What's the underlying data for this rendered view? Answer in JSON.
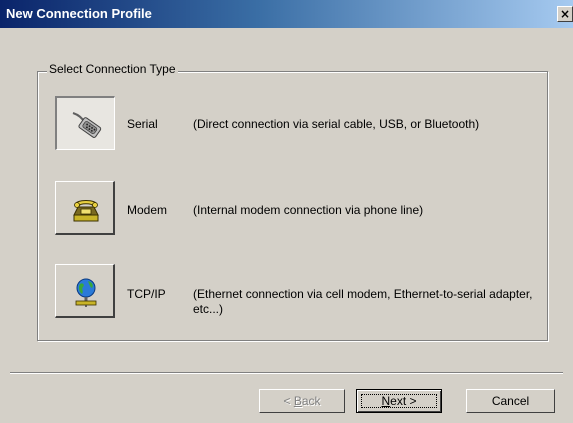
{
  "window": {
    "title": "New Connection Profile",
    "close_label": "×"
  },
  "group": {
    "legend": "Select Connection Type"
  },
  "options": [
    {
      "label": "Serial",
      "description": "(Direct connection via serial cable, USB, or Bluetooth)",
      "icon": "serial-cable-icon",
      "selected": true
    },
    {
      "label": "Modem",
      "description": "(Internal modem connection via phone line)",
      "icon": "telephone-modem-icon",
      "selected": false
    },
    {
      "label": "TCP/IP",
      "description": "(Ethernet connection via cell modem, Ethernet-to-serial adapter, etc...)",
      "icon": "network-globe-icon",
      "selected": false
    }
  ],
  "buttons": {
    "back_prefix": "< ",
    "back_mnemonic": "B",
    "back_rest": "ack",
    "next_mnemonic": "N",
    "next_rest": "ext >",
    "cancel": "Cancel"
  },
  "colors": {
    "dialog_bg": "#d4d0c8",
    "titlebar_start": "#0a246a",
    "titlebar_end": "#a6caf0"
  }
}
